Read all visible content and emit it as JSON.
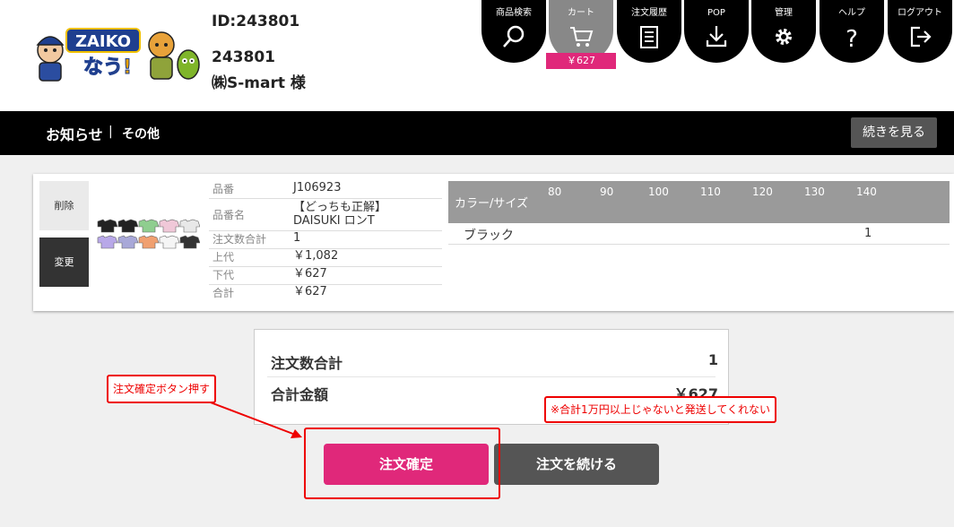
{
  "header": {
    "logo_text": "ZAIKO なう!",
    "user_id": "ID:243801",
    "user_code": "243801",
    "user_name": "㈱S-mart 様"
  },
  "nav": [
    {
      "label": "商品検索",
      "icon": "search-icon"
    },
    {
      "label": "カート",
      "icon": "cart-icon",
      "active": true
    },
    {
      "label": "注文履歴",
      "icon": "document-icon"
    },
    {
      "label": "POP",
      "icon": "download-icon"
    },
    {
      "label": "管理",
      "icon": "gear-icon"
    },
    {
      "label": "ヘルプ",
      "icon": "question-icon"
    },
    {
      "label": "ログアウト",
      "icon": "logout-icon"
    }
  ],
  "cart_amount": "￥627",
  "news": {
    "title": "お知らせ",
    "separator": "|",
    "subtitle": "その他",
    "more_label": "続きを見る"
  },
  "item": {
    "delete_label": "削除",
    "change_label": "変更",
    "rows": [
      {
        "label": "品番",
        "value": "J106923"
      },
      {
        "label": "品番名",
        "value": "【どっちも正解】 DAISUKI ロンT"
      },
      {
        "label": "注文数合計",
        "value": "1"
      },
      {
        "label": "上代",
        "value": "￥1,082"
      },
      {
        "label": "下代",
        "value": "￥627"
      },
      {
        "label": "合計",
        "value": "￥627"
      }
    ],
    "size_table": {
      "header_label": "カラー/サイズ",
      "sizes": [
        "80",
        "90",
        "100",
        "110",
        "120",
        "130",
        "140"
      ],
      "rows": [
        {
          "color": "ブラック",
          "qty_140": "1"
        }
      ]
    }
  },
  "summary": {
    "qty_label": "注文数合計",
    "qty_value": "1",
    "amount_label": "合計金額",
    "amount_value": "￥627"
  },
  "buttons": {
    "confirm": "注文確定",
    "continue": "注文を続ける"
  },
  "annotations": {
    "push_note": "注文確定ボタン押す",
    "min_note": "※合計1万円以上じゃないと発送してくれない"
  },
  "colors": {
    "accent": "#e0287a",
    "nav_bg": "#000000",
    "annotation": "#ee0000"
  }
}
